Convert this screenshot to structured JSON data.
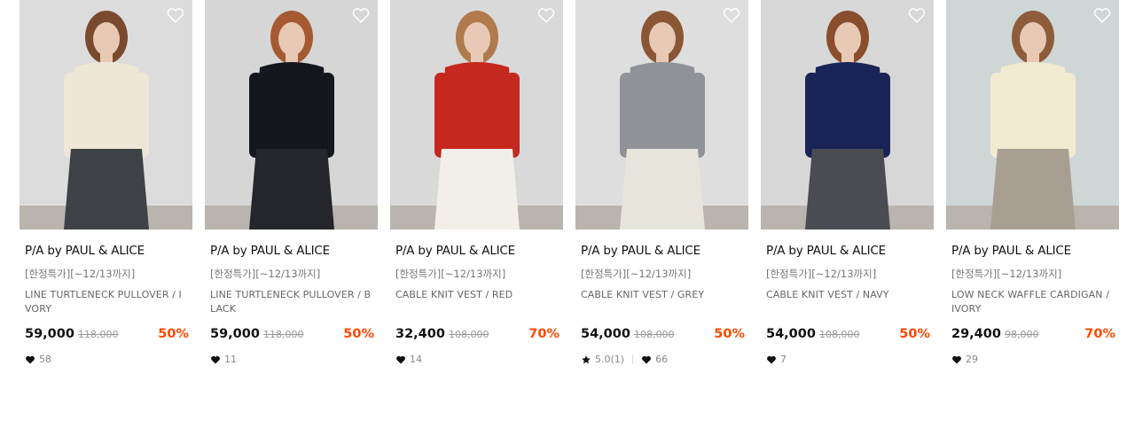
{
  "products": [
    {
      "brand": "P/A by PAUL & ALICE",
      "promo": "[한정특가][~12/13까지]",
      "name": "LINE TURTLENECK PULLOVER / IVORY",
      "price": "59,000",
      "original_price": "118,000",
      "discount": "50%",
      "likes": "58",
      "photo": {
        "bg": "#dcdcdc",
        "top": "#efe7d6",
        "bottom": "#3e4246",
        "hair": "#7a4a2e"
      }
    },
    {
      "brand": "P/A by PAUL & ALICE",
      "promo": "[한정특가][~12/13까지]",
      "name": "LINE TURTLENECK PULLOVER / BLACK",
      "price": "59,000",
      "original_price": "118,000",
      "discount": "50%",
      "likes": "11",
      "photo": {
        "bg": "#d6d6d6",
        "top": "#15171e",
        "bottom": "#25262b",
        "hair": "#a55a32"
      }
    },
    {
      "brand": "P/A by PAUL & ALICE",
      "promo": "[한정특가][~12/13까지]",
      "name": "CABLE KNIT VEST / RED",
      "price": "32,400",
      "original_price": "108,000",
      "discount": "70%",
      "likes": "14",
      "photo": {
        "bg": "#d9d9d9",
        "top": "#c5281f",
        "bottom": "#f2efe8",
        "hair": "#b07a4c"
      }
    },
    {
      "brand": "P/A by PAUL & ALICE",
      "promo": "[한정특가][~12/13까지]",
      "name": "CABLE KNIT VEST / GREY",
      "price": "54,000",
      "original_price": "108,000",
      "discount": "50%",
      "rating": "5.0(1)",
      "likes": "66",
      "photo": {
        "bg": "#dedede",
        "top": "#8f9296",
        "bottom": "#e7e4dc",
        "hair": "#8a5634"
      }
    },
    {
      "brand": "P/A by PAUL & ALICE",
      "promo": "[한정특가][~12/13까지]",
      "name": "CABLE KNIT VEST / NAVY",
      "price": "54,000",
      "original_price": "108,000",
      "discount": "50%",
      "likes": "7",
      "photo": {
        "bg": "#d7d7d7",
        "top": "#1b2456",
        "bottom": "#4a4c52",
        "hair": "#8a4e2c"
      }
    },
    {
      "brand": "P/A by PAUL & ALICE",
      "promo": "[한정특가][~12/13까지]",
      "name": "LOW NECK WAFFLE CARDIGAN / IVORY",
      "price": "29,400",
      "original_price": "98,000",
      "discount": "70%",
      "likes": "29",
      "photo": {
        "bg": "#cfd6d6",
        "top": "#f1ead0",
        "bottom": "#a89f92",
        "hair": "#8d5c3a"
      }
    }
  ],
  "colors": {
    "discount": "#ff4800",
    "text": "#111111",
    "muted": "#888888"
  },
  "icons": {
    "wishlist": "heart-outline-icon",
    "likes": "heart-filled-icon",
    "rating": "star-icon"
  }
}
